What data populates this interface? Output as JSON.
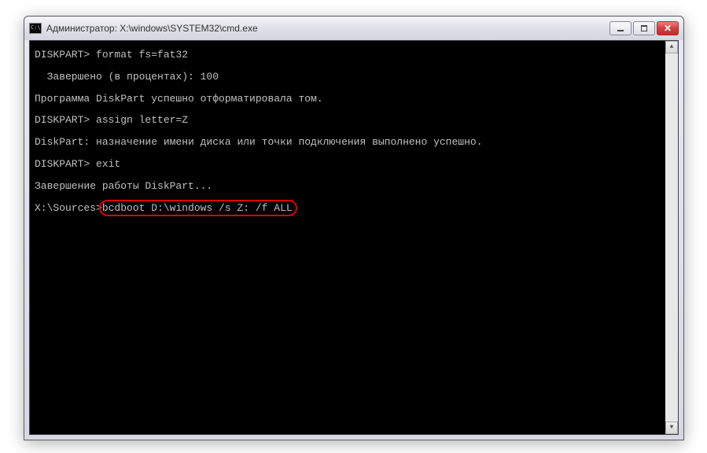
{
  "window": {
    "title": "Администратор: X:\\windows\\SYSTEM32\\cmd.exe"
  },
  "terminal": {
    "lines": [
      "DISKPART> format fs=fat32",
      "",
      "  Завершено (в процентах): 100",
      "",
      "Программа DiskPart успешно отформатировала том.",
      "",
      "DISKPART> assign letter=Z",
      "",
      "DiskPart: назначение имени диска или точки подключения выполнено успешно.",
      "",
      "DISKPART> exit",
      "",
      "Завершение работы DiskPart...",
      ""
    ],
    "prompt_line": {
      "prompt": "X:\\Sources>",
      "highlighted_command": "bcdboot D:\\windows /s Z: /f ALL"
    }
  }
}
